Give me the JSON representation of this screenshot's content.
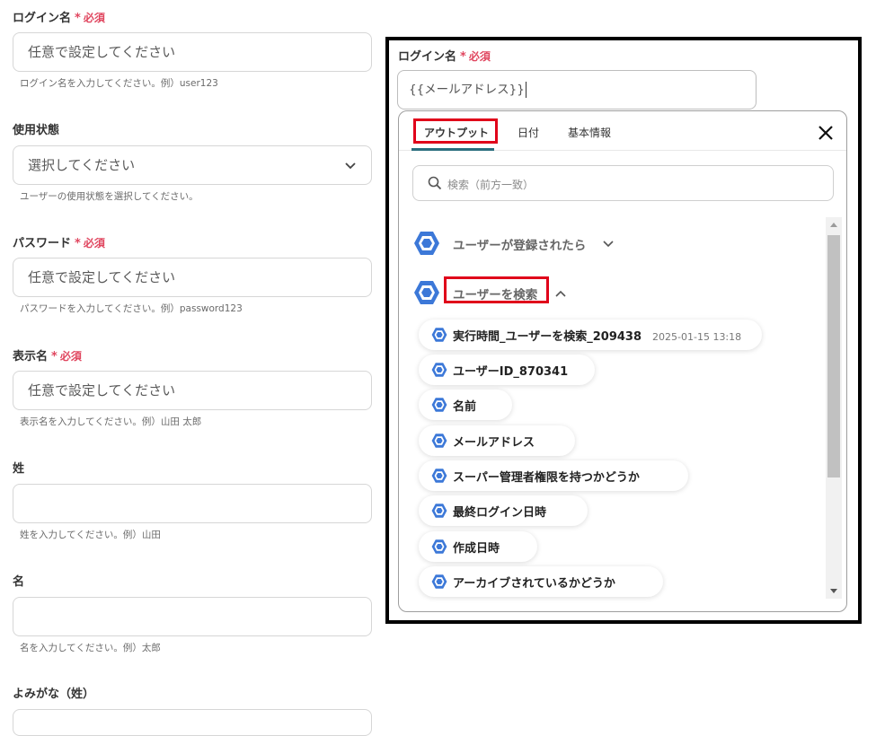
{
  "form": {
    "required_text": "必須",
    "fields": [
      {
        "label": "ログイン名",
        "required": true,
        "placeholder": "任意で設定してください",
        "hint": "ログイン名を入力してください。例）user123"
      },
      {
        "label": "使用状態",
        "required": false,
        "value": "選択してください",
        "hint": "ユーザーの使用状態を選択してください。"
      },
      {
        "label": "パスワード",
        "required": true,
        "placeholder": "任意で設定してください",
        "hint": "パスワードを入力してください。例）password123"
      },
      {
        "label": "表示名",
        "required": true,
        "placeholder": "任意で設定してください",
        "hint": "表示名を入力してください。例）山田 太郎"
      },
      {
        "label": "姓",
        "required": false,
        "placeholder": "",
        "hint": "姓を入力してください。例）山田"
      },
      {
        "label": "名",
        "required": false,
        "placeholder": "",
        "hint": "名を入力してください。例）太郎"
      },
      {
        "label": "よみがな（姓）",
        "required": false,
        "placeholder": ""
      }
    ]
  },
  "panel": {
    "label": "ログイン名",
    "required_text": "必須",
    "input_value": "{{メールアドレス}}",
    "tabs": [
      "アウトプット",
      "日付",
      "基本情報"
    ],
    "search_placeholder": "検索（前方一致）",
    "groups": [
      {
        "name": "ユーザーが登録されたら",
        "expanded": false
      },
      {
        "name": "ユーザーを検索",
        "expanded": true
      }
    ],
    "items": [
      {
        "label": "実行時間_ユーザーを検索_209438",
        "meta": "2025-01-15 13:18"
      },
      {
        "label": "ユーザーID_870341"
      },
      {
        "label": "名前"
      },
      {
        "label": "メールアドレス"
      },
      {
        "label": "スーパー管理者権限を持つかどうか"
      },
      {
        "label": "最終ログイン日時"
      },
      {
        "label": "作成日時"
      },
      {
        "label": "アーカイブされているかどうか"
      }
    ]
  },
  "colors": {
    "required": "#e0465f",
    "highlight": "#e0001a",
    "tab_underline": "#2a6e7e",
    "icon_blue": "#3c78d8"
  }
}
